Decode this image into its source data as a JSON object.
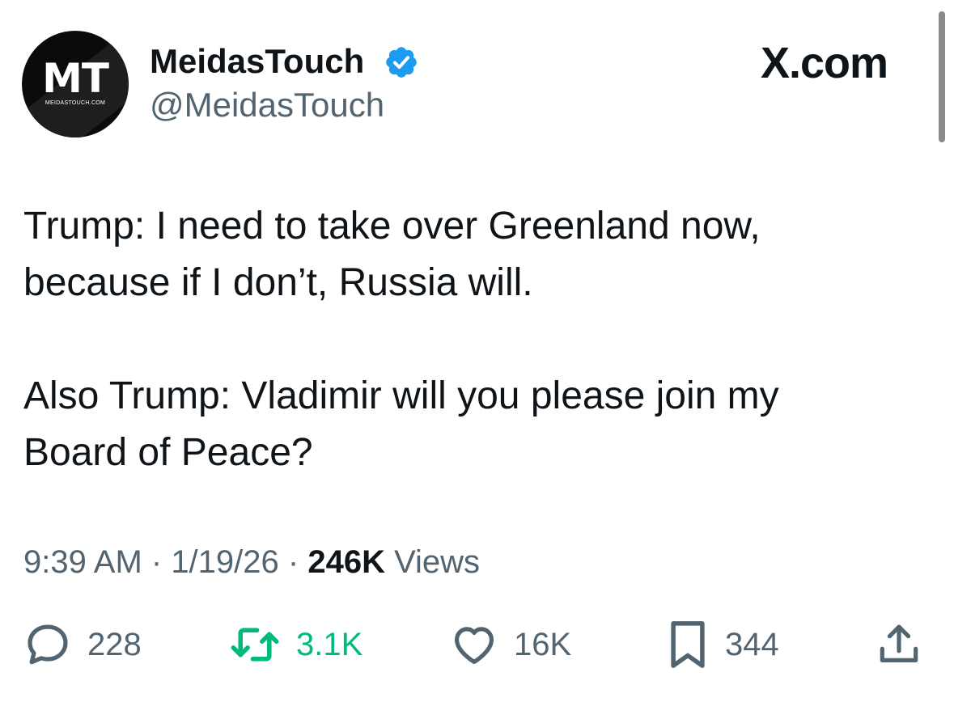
{
  "account": {
    "display_name": "MeidasTouch",
    "handle": "@MeidasTouch",
    "avatar_initials": "MT",
    "avatar_subtext": "MEIDASTOUCH.COM",
    "verified": true
  },
  "source_label": "X.com",
  "tweet": {
    "text": "Trump: I need to take over Greenland now,\nbecause if I don’t, Russia will.\n\nAlso Trump: Vladimir will you please join my\nBoard of Peace?",
    "time": "9:39 AM",
    "separator": " · ",
    "date": "1/19/26",
    "views_count": "246K",
    "views_label": " Views"
  },
  "actions": {
    "replies": "228",
    "reposts": "3.1K",
    "likes": "16K",
    "bookmarks": "344"
  },
  "icons": {
    "verified": "verified-badge-icon",
    "reply": "reply-bubble-icon",
    "repost": "repost-arrows-icon",
    "like": "heart-icon",
    "bookmark": "bookmark-icon",
    "share": "share-upload-icon"
  },
  "colors": {
    "text": "#0f1419",
    "secondary": "#536471",
    "verified_blue": "#1d9bf0",
    "repost_green": "#00ba7c"
  }
}
